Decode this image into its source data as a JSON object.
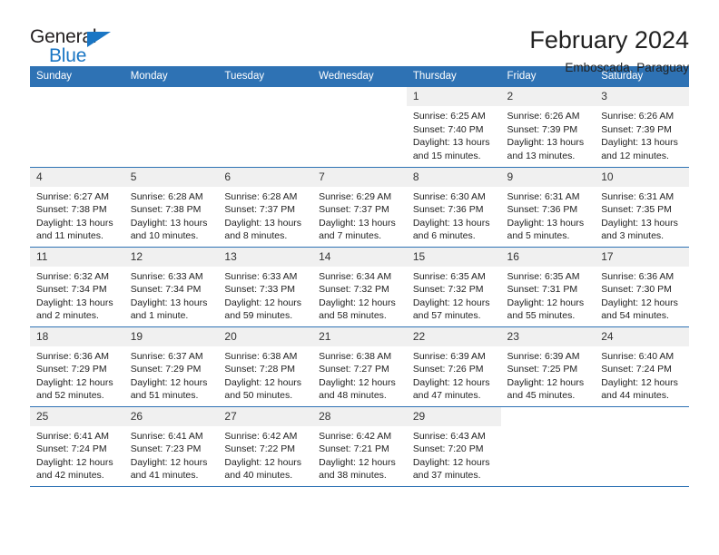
{
  "brand": {
    "name_part1": "General",
    "name_part2": "Blue",
    "triangle_icon": "triangle-icon",
    "accent_color": "#1a76c4"
  },
  "header": {
    "title": "February 2024",
    "subtitle": "Emboscada, Paraguay"
  },
  "theme": {
    "header_blue": "#2e72b4",
    "daynum_band": "#f0f0f0",
    "text": "#222222"
  },
  "calendar": {
    "weekday_headers": [
      "Sunday",
      "Monday",
      "Tuesday",
      "Wednesday",
      "Thursday",
      "Friday",
      "Saturday"
    ],
    "weeks": [
      [
        {
          "day": "",
          "lines": []
        },
        {
          "day": "",
          "lines": []
        },
        {
          "day": "",
          "lines": []
        },
        {
          "day": "",
          "lines": []
        },
        {
          "day": "1",
          "lines": [
            "Sunrise: 6:25 AM",
            "Sunset: 7:40 PM",
            "Daylight: 13 hours",
            "and 15 minutes."
          ]
        },
        {
          "day": "2",
          "lines": [
            "Sunrise: 6:26 AM",
            "Sunset: 7:39 PM",
            "Daylight: 13 hours",
            "and 13 minutes."
          ]
        },
        {
          "day": "3",
          "lines": [
            "Sunrise: 6:26 AM",
            "Sunset: 7:39 PM",
            "Daylight: 13 hours",
            "and 12 minutes."
          ]
        }
      ],
      [
        {
          "day": "4",
          "lines": [
            "Sunrise: 6:27 AM",
            "Sunset: 7:38 PM",
            "Daylight: 13 hours",
            "and 11 minutes."
          ]
        },
        {
          "day": "5",
          "lines": [
            "Sunrise: 6:28 AM",
            "Sunset: 7:38 PM",
            "Daylight: 13 hours",
            "and 10 minutes."
          ]
        },
        {
          "day": "6",
          "lines": [
            "Sunrise: 6:28 AM",
            "Sunset: 7:37 PM",
            "Daylight: 13 hours",
            "and 8 minutes."
          ]
        },
        {
          "day": "7",
          "lines": [
            "Sunrise: 6:29 AM",
            "Sunset: 7:37 PM",
            "Daylight: 13 hours",
            "and 7 minutes."
          ]
        },
        {
          "day": "8",
          "lines": [
            "Sunrise: 6:30 AM",
            "Sunset: 7:36 PM",
            "Daylight: 13 hours",
            "and 6 minutes."
          ]
        },
        {
          "day": "9",
          "lines": [
            "Sunrise: 6:31 AM",
            "Sunset: 7:36 PM",
            "Daylight: 13 hours",
            "and 5 minutes."
          ]
        },
        {
          "day": "10",
          "lines": [
            "Sunrise: 6:31 AM",
            "Sunset: 7:35 PM",
            "Daylight: 13 hours",
            "and 3 minutes."
          ]
        }
      ],
      [
        {
          "day": "11",
          "lines": [
            "Sunrise: 6:32 AM",
            "Sunset: 7:34 PM",
            "Daylight: 13 hours",
            "and 2 minutes."
          ]
        },
        {
          "day": "12",
          "lines": [
            "Sunrise: 6:33 AM",
            "Sunset: 7:34 PM",
            "Daylight: 13 hours",
            "and 1 minute."
          ]
        },
        {
          "day": "13",
          "lines": [
            "Sunrise: 6:33 AM",
            "Sunset: 7:33 PM",
            "Daylight: 12 hours",
            "and 59 minutes."
          ]
        },
        {
          "day": "14",
          "lines": [
            "Sunrise: 6:34 AM",
            "Sunset: 7:32 PM",
            "Daylight: 12 hours",
            "and 58 minutes."
          ]
        },
        {
          "day": "15",
          "lines": [
            "Sunrise: 6:35 AM",
            "Sunset: 7:32 PM",
            "Daylight: 12 hours",
            "and 57 minutes."
          ]
        },
        {
          "day": "16",
          "lines": [
            "Sunrise: 6:35 AM",
            "Sunset: 7:31 PM",
            "Daylight: 12 hours",
            "and 55 minutes."
          ]
        },
        {
          "day": "17",
          "lines": [
            "Sunrise: 6:36 AM",
            "Sunset: 7:30 PM",
            "Daylight: 12 hours",
            "and 54 minutes."
          ]
        }
      ],
      [
        {
          "day": "18",
          "lines": [
            "Sunrise: 6:36 AM",
            "Sunset: 7:29 PM",
            "Daylight: 12 hours",
            "and 52 minutes."
          ]
        },
        {
          "day": "19",
          "lines": [
            "Sunrise: 6:37 AM",
            "Sunset: 7:29 PM",
            "Daylight: 12 hours",
            "and 51 minutes."
          ]
        },
        {
          "day": "20",
          "lines": [
            "Sunrise: 6:38 AM",
            "Sunset: 7:28 PM",
            "Daylight: 12 hours",
            "and 50 minutes."
          ]
        },
        {
          "day": "21",
          "lines": [
            "Sunrise: 6:38 AM",
            "Sunset: 7:27 PM",
            "Daylight: 12 hours",
            "and 48 minutes."
          ]
        },
        {
          "day": "22",
          "lines": [
            "Sunrise: 6:39 AM",
            "Sunset: 7:26 PM",
            "Daylight: 12 hours",
            "and 47 minutes."
          ]
        },
        {
          "day": "23",
          "lines": [
            "Sunrise: 6:39 AM",
            "Sunset: 7:25 PM",
            "Daylight: 12 hours",
            "and 45 minutes."
          ]
        },
        {
          "day": "24",
          "lines": [
            "Sunrise: 6:40 AM",
            "Sunset: 7:24 PM",
            "Daylight: 12 hours",
            "and 44 minutes."
          ]
        }
      ],
      [
        {
          "day": "25",
          "lines": [
            "Sunrise: 6:41 AM",
            "Sunset: 7:24 PM",
            "Daylight: 12 hours",
            "and 42 minutes."
          ]
        },
        {
          "day": "26",
          "lines": [
            "Sunrise: 6:41 AM",
            "Sunset: 7:23 PM",
            "Daylight: 12 hours",
            "and 41 minutes."
          ]
        },
        {
          "day": "27",
          "lines": [
            "Sunrise: 6:42 AM",
            "Sunset: 7:22 PM",
            "Daylight: 12 hours",
            "and 40 minutes."
          ]
        },
        {
          "day": "28",
          "lines": [
            "Sunrise: 6:42 AM",
            "Sunset: 7:21 PM",
            "Daylight: 12 hours",
            "and 38 minutes."
          ]
        },
        {
          "day": "29",
          "lines": [
            "Sunrise: 6:43 AM",
            "Sunset: 7:20 PM",
            "Daylight: 12 hours",
            "and 37 minutes."
          ]
        },
        {
          "day": "",
          "lines": []
        },
        {
          "day": "",
          "lines": []
        }
      ]
    ]
  }
}
